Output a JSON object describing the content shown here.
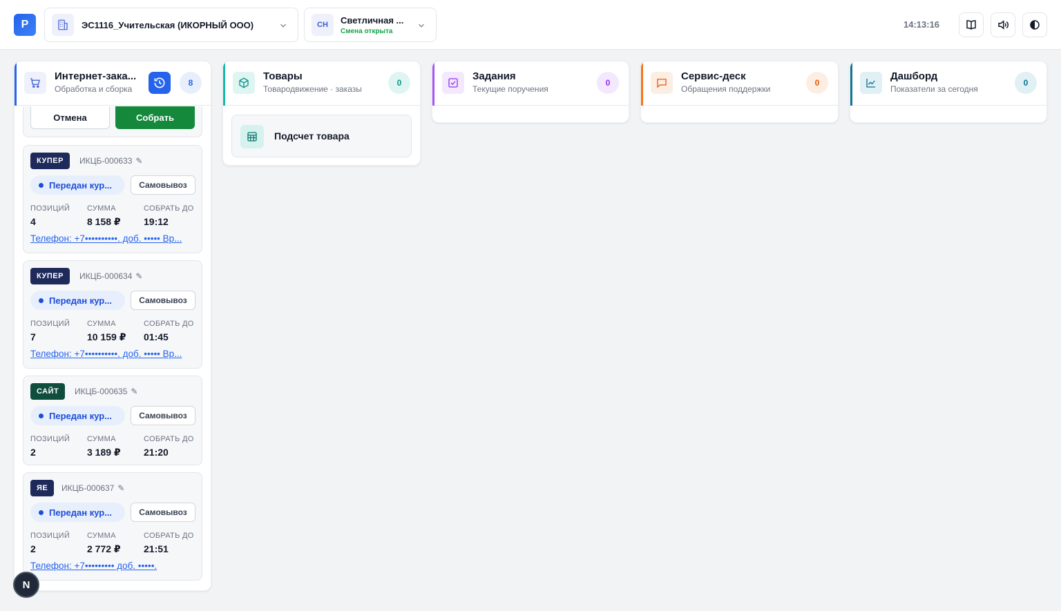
{
  "app": {
    "logo_letter": "P"
  },
  "store": {
    "name": "ЭС1116_Учительская (ИКОРНЫЙ ООО)"
  },
  "user": {
    "initials": "СН",
    "name": "Светличная ...",
    "status": "Смена открыта"
  },
  "clock": "14:13:16",
  "colors": {
    "accent": "#2563eb",
    "green": "#15893b",
    "teal": "#14b8a6",
    "purple": "#a855f7",
    "orange": "#f97316",
    "navy": "#1e2a5a",
    "dark_green": "#0f4d3c"
  },
  "columns": {
    "orders": {
      "title": "Интернет-зака...",
      "subtitle": "Обработка и сборка",
      "count": "8",
      "cancel_label": "Отмена",
      "collect_label": "Собрать"
    },
    "goods": {
      "title": "Товары",
      "subtitle": "Товародвижение · заказы",
      "count": "0",
      "card_label": "Подсчет товара"
    },
    "tasks": {
      "title": "Задания",
      "subtitle": "Текущие поручения",
      "count": "0"
    },
    "service": {
      "title": "Сервис-деск",
      "subtitle": "Обращения поддержки",
      "count": "0"
    },
    "dashboard": {
      "title": "Дашборд",
      "subtitle": "Показатели за сегодня",
      "count": "0"
    }
  },
  "order_labels": {
    "positions": "ПОЗИЦИЙ",
    "sum": "СУММА",
    "deadline": "СОБРАТЬ ДО"
  },
  "orders": [
    {
      "source": "КУПЕР",
      "id": "ИКЦБ-000633",
      "status": "Передан кур...",
      "delivery": "Самовывоз",
      "positions": "4",
      "sum": "8 158 ₽",
      "deadline": "19:12",
      "phone": "Телефон: +7••••••••••. доб. ••••• Вр..."
    },
    {
      "source": "КУПЕР",
      "id": "ИКЦБ-000634",
      "status": "Передан кур...",
      "delivery": "Самовывоз",
      "positions": "7",
      "sum": "10 159 ₽",
      "deadline": "01:45",
      "phone": "Телефон: +7••••••••••. доб. ••••• Вр..."
    },
    {
      "source": "САЙТ",
      "id": "ИКЦБ-000635",
      "status": "Передан кур...",
      "delivery": "Самовывоз",
      "positions": "2",
      "sum": "3 189 ₽",
      "deadline": "21:20",
      "phone": ""
    },
    {
      "source": "ЯЕ",
      "id": "ИКЦБ-000637",
      "status": "Передан кур...",
      "delivery": "Самовывоз",
      "positions": "2",
      "sum": "2 772 ₽",
      "deadline": "21:51",
      "phone": "Телефон: +7••••••••• доб. •••••."
    }
  ],
  "bottom": {
    "n_letter": "N"
  }
}
